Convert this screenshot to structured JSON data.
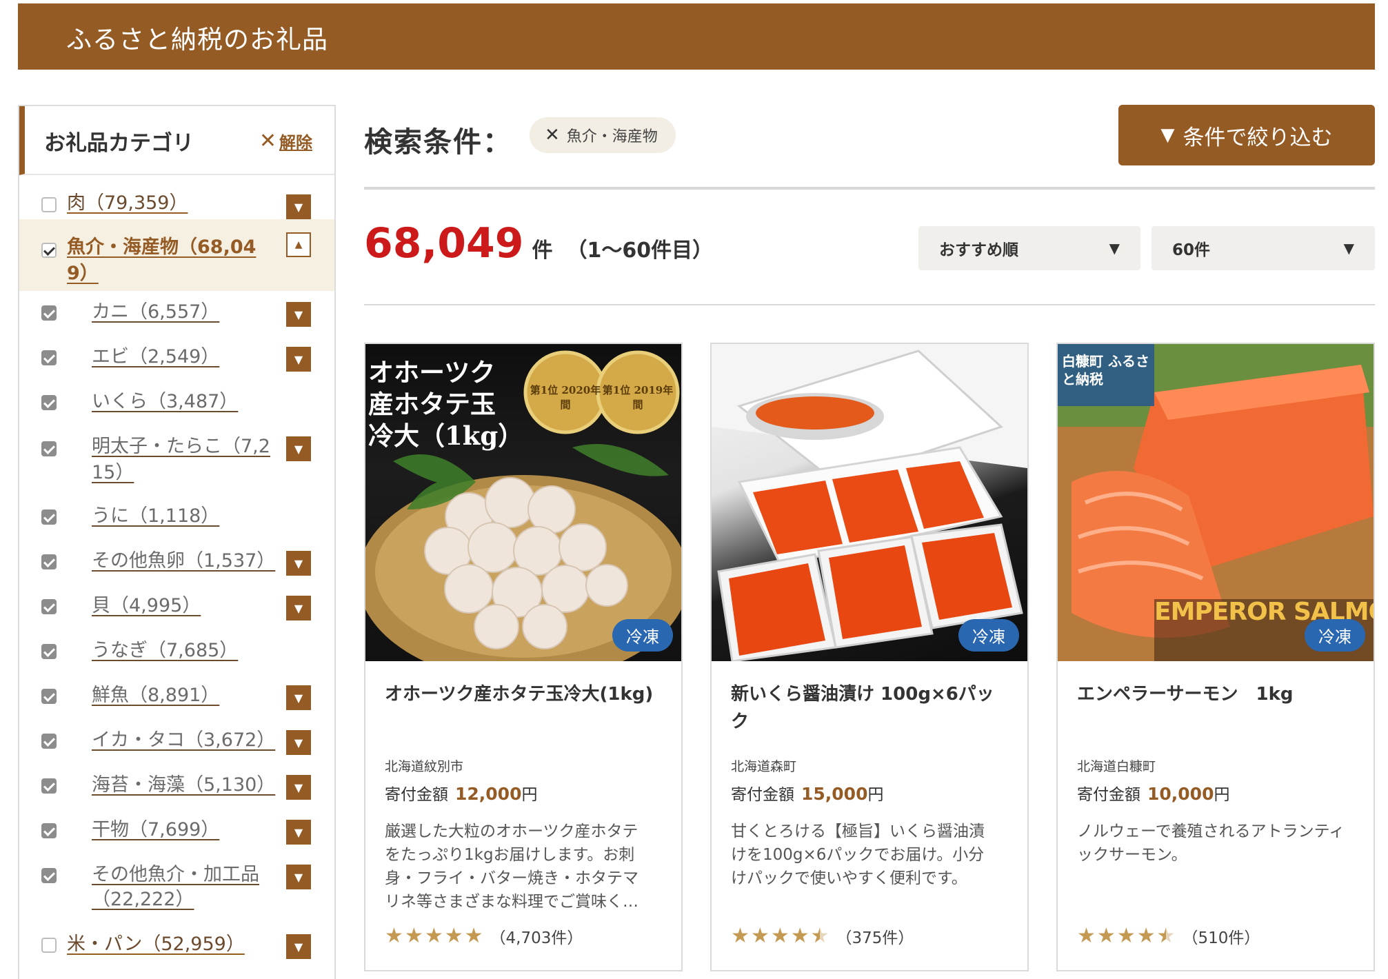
{
  "header": {
    "title": "ふるさと納税のお礼品"
  },
  "sidebar": {
    "title": "お礼品カテゴリ",
    "clear_label": "解除",
    "items": [
      {
        "label": "肉（79,359）",
        "state": "unchecked"
      },
      {
        "label": "魚介・海産物（68,049）",
        "state": "checked",
        "label_line1": "魚介・海産物（68,04",
        "label_line2": "9）"
      },
      {
        "label": "カニ（6,557）",
        "state": "checked"
      },
      {
        "label": "エビ（2,549）",
        "state": "checked"
      },
      {
        "label": "いくら（3,487）",
        "state": "checked"
      },
      {
        "label": "明太子・たらこ（7,215）",
        "state": "checked",
        "label_line1": "明太子・たらこ（7,2",
        "label_line2": "15）"
      },
      {
        "label": "うに（1,118）",
        "state": "checked"
      },
      {
        "label": "その他魚卵（1,537）",
        "state": "checked"
      },
      {
        "label": "貝（4,995）",
        "state": "checked"
      },
      {
        "label": "うなぎ（7,685）",
        "state": "checked"
      },
      {
        "label": "鮮魚（8,891）",
        "state": "checked"
      },
      {
        "label": "イカ・タコ（3,672）",
        "state": "checked"
      },
      {
        "label": "海苔・海藻（5,130）",
        "state": "checked"
      },
      {
        "label": "干物（7,699）",
        "state": "checked"
      },
      {
        "label": "その他魚介・加工品（22,222）",
        "state": "checked",
        "label_line1": "その他魚介・加工品",
        "label_line2": "（22,222）"
      },
      {
        "label": "米・パン（52,959）",
        "state": "unchecked"
      }
    ]
  },
  "search": {
    "label": "検索条件：",
    "chip": "魚介・海産物",
    "filter_button": "条件で絞り込む"
  },
  "results": {
    "count": "68,049",
    "unit": "件",
    "range": "（1〜60件目）",
    "sort_selected": "おすすめ順",
    "per_page_selected": "60件"
  },
  "products": [
    {
      "image_text_main": "オホーツク産ホタテ玉冷大（1kg）",
      "image_text_rank1": "第1位 2020年間",
      "image_text_rank2": "第1位 2019年間",
      "badge": "冷凍",
      "title": "オホーツク産ホタテ玉冷大(1kg)",
      "city": "北海道紋別市",
      "price_label": "寄付金額",
      "price_value": "12,000",
      "price_unit": "円",
      "description": "厳選した大粒のオホーツク産ホタテをたっぷり1kgお届けします。お刺身・フライ・バター焼き・ホタテマリネ等さまざまな料理でご賞味く…",
      "rating": 5,
      "reviews": "（4,703件）"
    },
    {
      "badge": "冷凍",
      "title": "新いくら醤油漬け 100g×6パック",
      "city": "北海道森町",
      "price_label": "寄付金額",
      "price_value": "15,000",
      "price_unit": "円",
      "description": "甘くとろける【極旨】いくら醤油漬けを100g×6パックでお届け。小分けパックで使いやすく便利です。",
      "rating": 4.5,
      "reviews": "（375件）"
    },
    {
      "image_text_top": "白糠町 ふるさと納税",
      "image_text_brand": "EMPEROR SALMON",
      "badge": "冷凍",
      "title": "エンペラーサーモン　1kg",
      "city": "北海道白糠町",
      "price_label": "寄付金額",
      "price_value": "10,000",
      "price_unit": "円",
      "description": "ノルウェーで養殖されるアトランティックサーモン。",
      "rating": 4.5,
      "reviews": "（510件）"
    }
  ]
}
